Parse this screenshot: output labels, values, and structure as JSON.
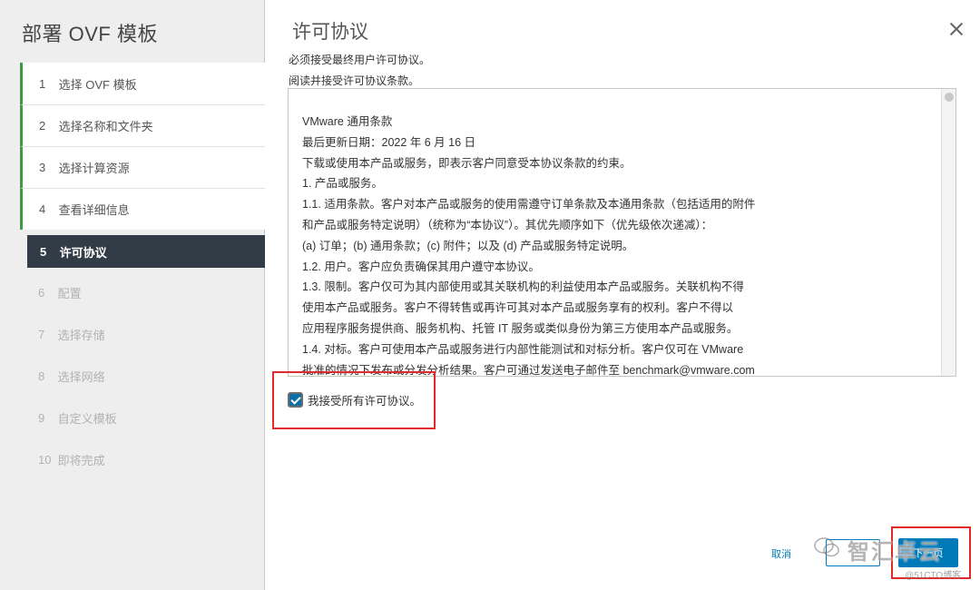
{
  "wizard": {
    "title": "部署 OVF 模板",
    "steps": [
      {
        "num": "1",
        "label": "选择 OVF 模板",
        "state": "done"
      },
      {
        "num": "2",
        "label": "选择名称和文件夹",
        "state": "done"
      },
      {
        "num": "3",
        "label": "选择计算资源",
        "state": "done"
      },
      {
        "num": "4",
        "label": "查看详细信息",
        "state": "done"
      },
      {
        "num": "5",
        "label": "许可协议",
        "state": "current"
      },
      {
        "num": "6",
        "label": "配置",
        "state": "pending"
      },
      {
        "num": "7",
        "label": "选择存储",
        "state": "pending"
      },
      {
        "num": "8",
        "label": "选择网络",
        "state": "pending"
      },
      {
        "num": "9",
        "label": "自定义模板",
        "state": "pending"
      },
      {
        "num": "10",
        "label": "即将完成",
        "state": "pending"
      }
    ]
  },
  "page": {
    "title": "许可协议",
    "instruction1": "必须接受最终用户许可协议。",
    "instruction2": "阅读并接受许可协议条款。"
  },
  "eula": {
    "lines": [
      "VMware 通用条款",
      "最后更新日期：2022 年 6 月 16 日",
      "下载或使用本产品或服务，即表示客户同意受本协议条款的约束。",
      "1. 产品或服务。",
      "1.1. 适用条款。客户对本产品或服务的使用需遵守订单条款及本通用条款（包括适用的附件",
      "和产品或服务特定说明）（统称为“本协议”）。其优先顺序如下（优先级依次递减）：",
      "(a) 订单；(b) 通用条款；(c) 附件；以及 (d) 产品或服务特定说明。",
      "1.2. 用户。客户应负责确保其用户遵守本协议。",
      "1.3. 限制。客户仅可为其内部使用或其关联机构的利益使用本产品或服务。关联机构不得",
      "使用本产品或服务。客户不得转售或再许可其对本产品或服务享有的权利。客户不得以",
      "应用程序服务提供商、服务机构、托管 IT 服务或类似身份为第三方使用本产品或服务。",
      "1.4. 对标。客户可使用本产品或服务进行内部性能测试和对标分析。客户仅可在 VMware",
      "批准的情况下发布或分发分析结果。客户可通过发送电子邮件至 benchmark@vmware.com"
    ]
  },
  "accept": {
    "label": "我接受所有许可协议。",
    "checked": true
  },
  "footer": {
    "cancel_label": "取消",
    "next_label": "下一页"
  },
  "watermark": {
    "text": "智汇卓云",
    "sub": "@51CTO博客"
  },
  "colors": {
    "accent": "#0079b8",
    "sidebar_current": "#313c46",
    "done_bar": "#3d9c3d",
    "highlight_frame": "#e12b2b"
  }
}
